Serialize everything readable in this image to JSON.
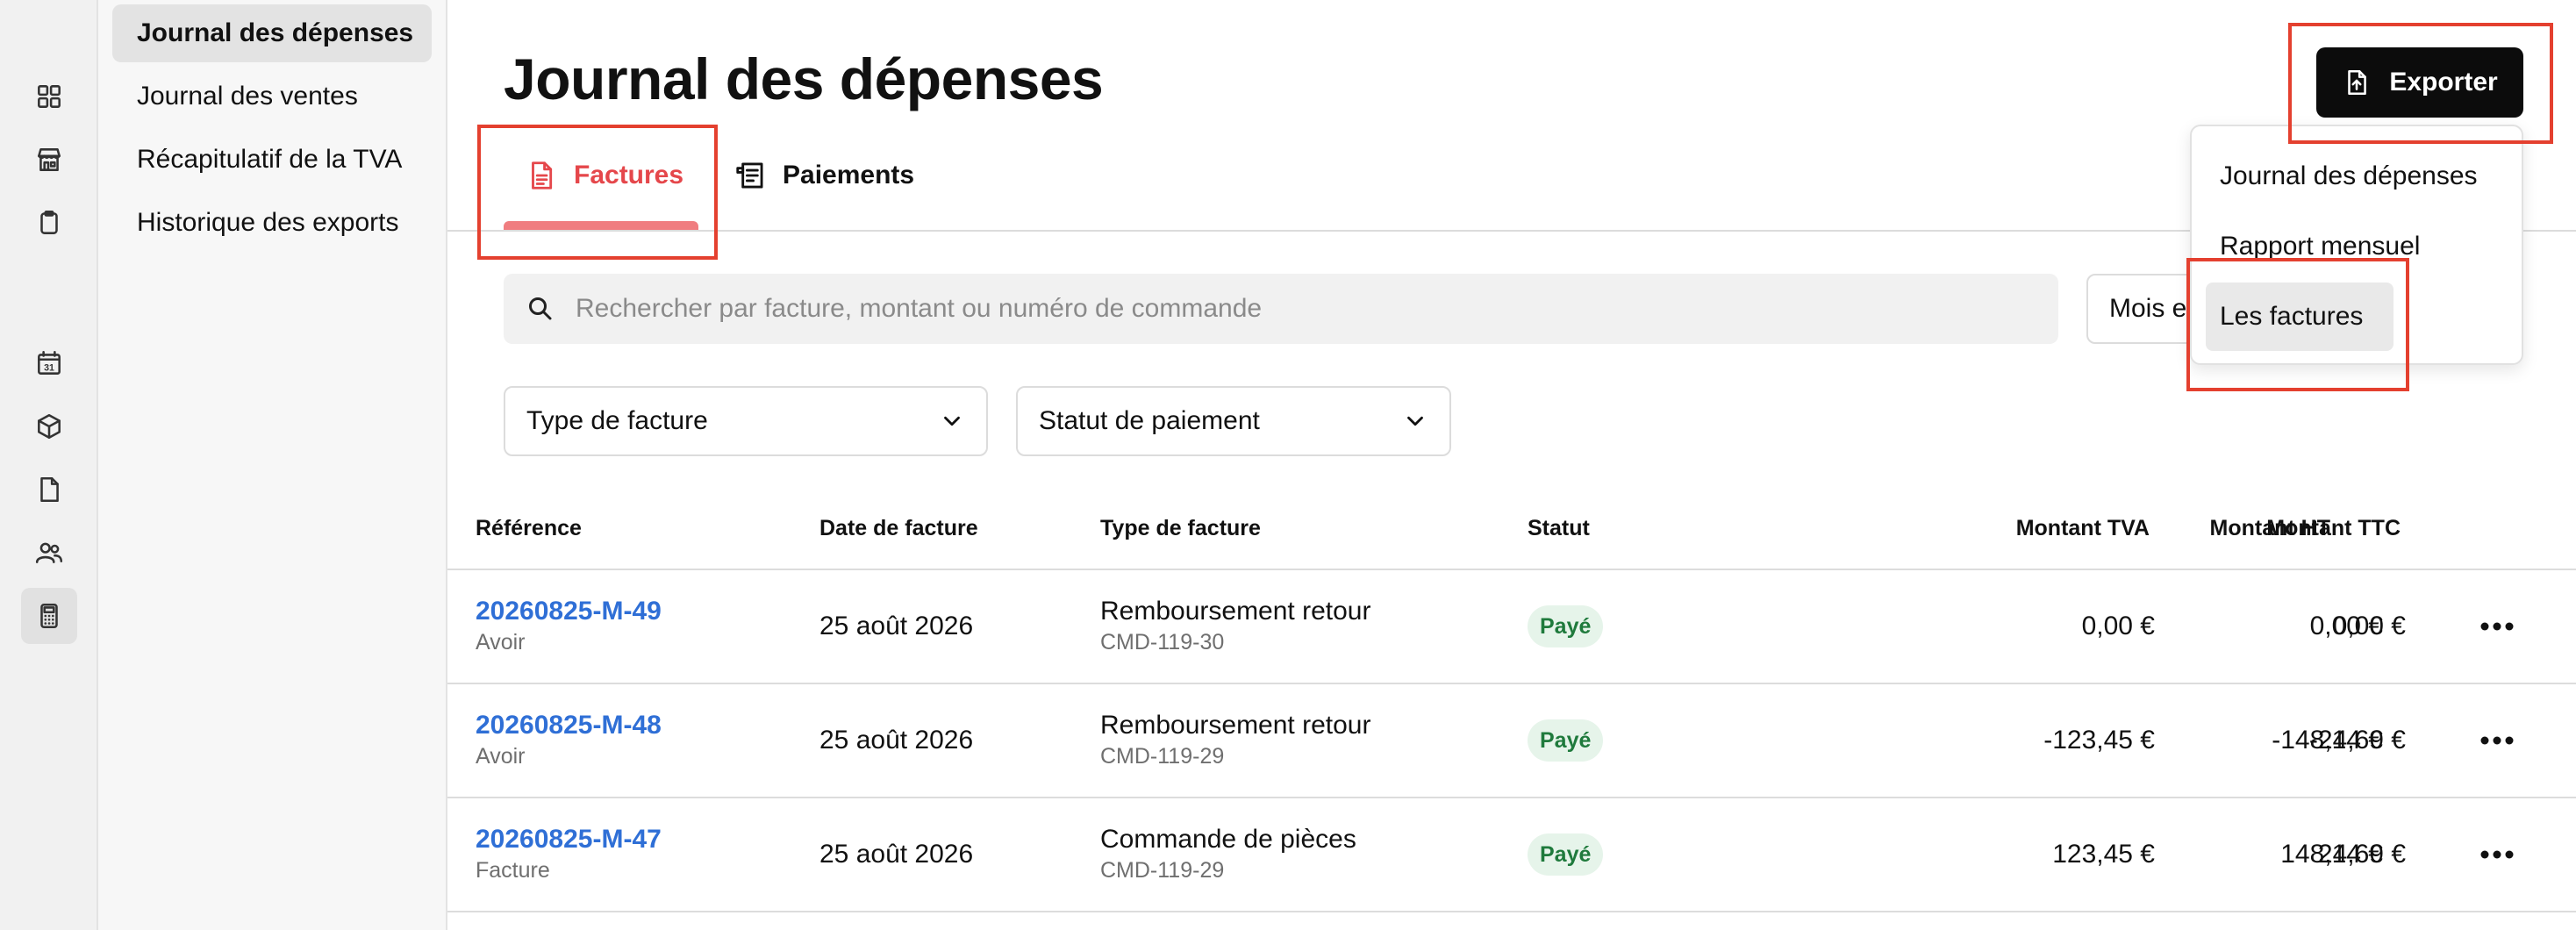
{
  "rail": {
    "icons": [
      "dashboard-icon",
      "store-icon",
      "clipboard-icon",
      "calendar-icon",
      "box-icon",
      "document-icon",
      "users-icon",
      "calculator-icon"
    ],
    "calendar_day": "31"
  },
  "subnav": {
    "items": [
      {
        "label": "Journal des dépenses",
        "active": true
      },
      {
        "label": "Journal des ventes",
        "active": false
      },
      {
        "label": "Récapitulatif de la TVA",
        "active": false
      },
      {
        "label": "Historique des exports",
        "active": false
      }
    ]
  },
  "header": {
    "title": "Journal des dépenses"
  },
  "tabs": [
    {
      "label": "Factures",
      "active": true
    },
    {
      "label": "Paiements",
      "active": false
    }
  ],
  "filters": {
    "search_placeholder": "Rechercher par facture, montant ou numéro de commande",
    "month_label": "Mois e",
    "invoice_type_label": "Type de facture",
    "payment_status_label": "Statut de paiement"
  },
  "export": {
    "button_label": "Exporter",
    "menu": [
      "Journal des dépenses",
      "Rapport mensuel",
      "Les factures"
    ]
  },
  "table": {
    "columns": [
      "Référence",
      "Date de facture",
      "Type de facture",
      "Statut",
      "Montant HT",
      "Montant TVA",
      "Montant TTC"
    ],
    "rows": [
      {
        "reference": "20260825-M-49",
        "doc_type": "Avoir",
        "date": "25 août 2026",
        "invoice_type": "Remboursement retour",
        "order": "CMD-119-30",
        "status": "Payé",
        "ht": "0,00 €",
        "tva": "0,00 €",
        "ttc": "0,00 €"
      },
      {
        "reference": "20260825-M-48",
        "doc_type": "Avoir",
        "date": "25 août 2026",
        "invoice_type": "Remboursement retour",
        "order": "CMD-119-29",
        "status": "Payé",
        "ht": "-123,45 €",
        "tva": "-24,69 €",
        "ttc": "-148,14 €"
      },
      {
        "reference": "20260825-M-47",
        "doc_type": "Facture",
        "date": "25 août 2026",
        "invoice_type": "Commande de pièces",
        "order": "CMD-119-29",
        "status": "Payé",
        "ht": "123,45 €",
        "tva": "24,69 €",
        "ttc": "148,14 €"
      }
    ]
  },
  "colors": {
    "accent": "#e5474b",
    "link": "#2f6fd6",
    "badge_bg": "#e6f4ea",
    "badge_text": "#1f7a3c",
    "highlight": "#e4402f"
  }
}
